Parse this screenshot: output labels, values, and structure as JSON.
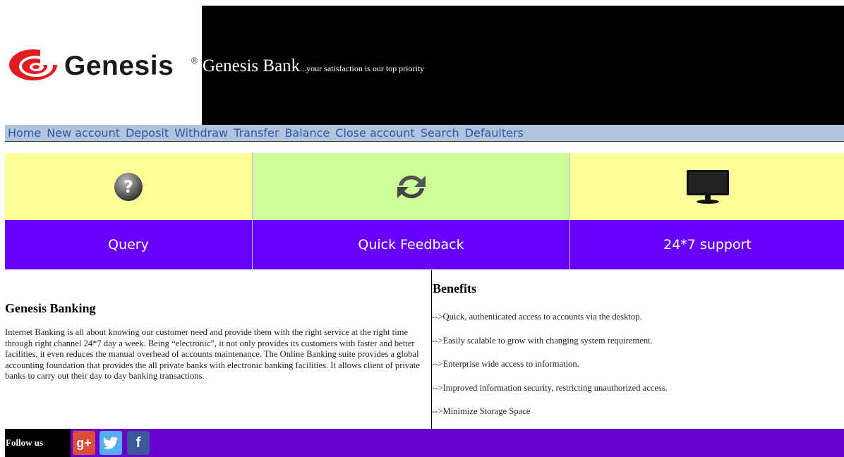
{
  "header": {
    "logo_text": "Genesis",
    "logo_reg": "®",
    "bank_name": "Genesis Bank",
    "tagline": "...your satisfaction is our top priority"
  },
  "nav": {
    "items": [
      "Home",
      "New account",
      "Deposit",
      "Withdraw",
      "Transfer",
      "Balance",
      "Close account",
      "Search",
      "Defaulters"
    ]
  },
  "features": [
    {
      "label": "Query",
      "icon": "question-icon",
      "bg": "#ffff99"
    },
    {
      "label": "Quick Feedback",
      "icon": "refresh-icon",
      "bg": "#ccff99"
    },
    {
      "label": "24*7 support",
      "icon": "monitor-icon",
      "bg": "#ffff99"
    }
  ],
  "about": {
    "title": "Genesis Banking",
    "text": "Internet Banking is all about knowing our customer need and provide them with the right service at the right time through right channel 24*7 day a week. Being “electronic”, it not only provides its customers with faster and better facilities, it even reduces the manual overhead of accounts maintenance. The Online Banking suite provides a global accounting foundation that provides the all private banks with electronic banking facilities. It allows client of private banks to carry out their day to day banking transactions."
  },
  "benefits": {
    "title": "Benefits",
    "items": [
      "-->Quick, authenticated access to accounts via the desktop.",
      "-->Easily scalable to grow with changing system requirement.",
      "-->Enterprise wide access to information.",
      "-->Improved information security, restricting unauthorized access.",
      "-->Minimize Storage Space"
    ]
  },
  "footer": {
    "follow_label": "Follow us",
    "social": [
      {
        "name": "google-plus-icon",
        "glyph": "g+",
        "color": "#dd4b39"
      },
      {
        "name": "twitter-icon",
        "glyph": "🐦",
        "color": "#55acee"
      },
      {
        "name": "facebook-icon",
        "glyph": "f",
        "color": "#3b5998"
      }
    ]
  },
  "colors": {
    "header_bg": "#000000",
    "nav_bg": "#b0c4de",
    "nav_text": "#3457a0",
    "feature_label_bg": "#6600ff",
    "footer_bg": "#6600cc"
  }
}
